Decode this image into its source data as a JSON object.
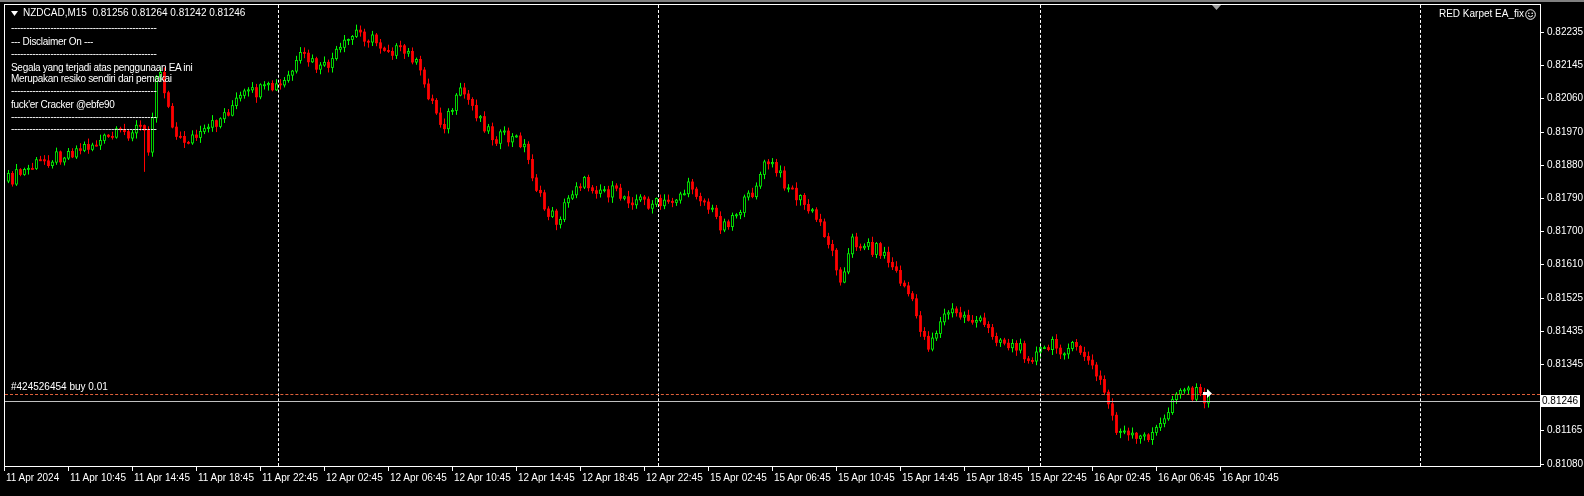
{
  "chart": {
    "header": "NZDCAD,M15  0.81256 0.81264 0.81242 0.81246",
    "comment_lines": [
      "------------------------------------------------",
      "--- Disclaimer On ---",
      "------------------------------------------------",
      "Segala yang terjadi atas penggunaan EA ini",
      "Merupakan resiko sendiri dari pemakai",
      "------------------------------------------------",
      "fuck'er Cracker @ebfe90",
      "------------------------------------------------",
      "------------------------------------------------"
    ],
    "expert_name": "RED Karpet EA_fix",
    "order_label": "#424526454 buy 0.01",
    "bid_tag": "0.81246"
  },
  "price_axis": [
    "0.82235",
    "0.82145",
    "0.82060",
    "0.81970",
    "0.81880",
    "0.81790",
    "0.81700",
    "0.81610",
    "0.81525",
    "0.81435",
    "0.81345",
    "0.81165",
    "0.81080"
  ],
  "time_axis": [
    "11 Apr 2024",
    "11 Apr 10:45",
    "11 Apr 14:45",
    "11 Apr 18:45",
    "11 Apr 22:45",
    "12 Apr 02:45",
    "12 Apr 06:45",
    "12 Apr 10:45",
    "12 Apr 14:45",
    "12 Apr 18:45",
    "12 Apr 22:45",
    "15 Apr 02:45",
    "15 Apr 06:45",
    "15 Apr 10:45",
    "15 Apr 14:45",
    "15 Apr 18:45",
    "15 Apr 22:45",
    "16 Apr 02:45",
    "16 Apr 06:45",
    "16 Apr 10:45"
  ]
}
